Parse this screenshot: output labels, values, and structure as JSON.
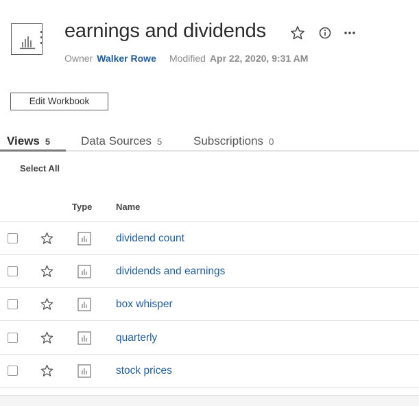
{
  "workbook": {
    "title": "earnings and dividends",
    "owner_label": "Owner",
    "owner_name": "Walker Rowe",
    "modified_label": "Modified",
    "modified_value": "Apr 22, 2020, 9:31 AM",
    "header_icons": [
      "star-icon",
      "info-icon",
      "more-icon"
    ]
  },
  "edit_button_label": "Edit Workbook",
  "tabs": [
    {
      "label": "Views",
      "count": "5",
      "active": true
    },
    {
      "label": "Data Sources",
      "count": "5",
      "active": false
    },
    {
      "label": "Subscriptions",
      "count": "0",
      "active": false
    }
  ],
  "select_all_label": "Select All",
  "table": {
    "columns": {
      "type": "Type",
      "name": "Name"
    },
    "rows": [
      {
        "name": "dividend count",
        "icon": "view-chart-icon"
      },
      {
        "name": "dividends and earnings",
        "icon": "view-chart-icon"
      },
      {
        "name": "box whisper",
        "icon": "view-chart-icon"
      },
      {
        "name": "quarterly",
        "icon": "view-chart-icon"
      },
      {
        "name": "stock prices",
        "icon": "view-chart-icon"
      }
    ]
  },
  "colors": {
    "link": "#1f5c99",
    "text": "#2b2b2b",
    "muted": "#8b8b8b",
    "rule": "#e1e1e1"
  }
}
